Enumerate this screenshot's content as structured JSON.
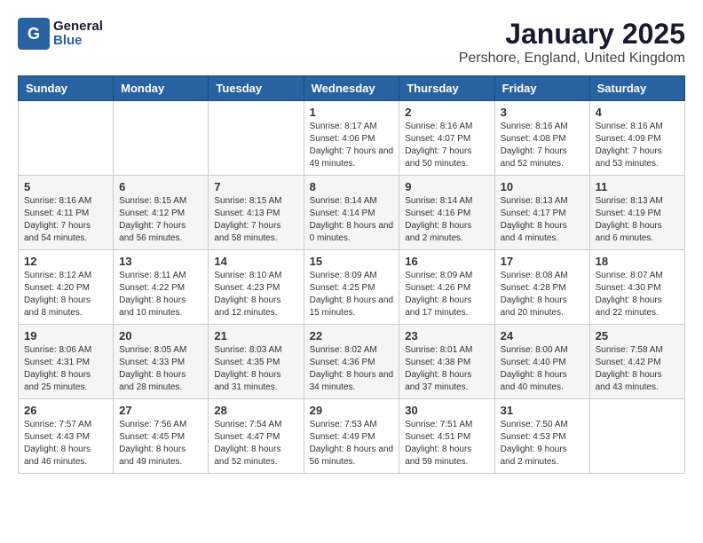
{
  "logo": {
    "general": "General",
    "blue": "Blue"
  },
  "title": "January 2025",
  "location": "Pershore, England, United Kingdom",
  "days_of_week": [
    "Sunday",
    "Monday",
    "Tuesday",
    "Wednesday",
    "Thursday",
    "Friday",
    "Saturday"
  ],
  "weeks": [
    [
      {
        "day": "",
        "sunrise": "",
        "sunset": "",
        "daylight": ""
      },
      {
        "day": "",
        "sunrise": "",
        "sunset": "",
        "daylight": ""
      },
      {
        "day": "",
        "sunrise": "",
        "sunset": "",
        "daylight": ""
      },
      {
        "day": "1",
        "sunrise": "Sunrise: 8:17 AM",
        "sunset": "Sunset: 4:06 PM",
        "daylight": "Daylight: 7 hours and 49 minutes."
      },
      {
        "day": "2",
        "sunrise": "Sunrise: 8:16 AM",
        "sunset": "Sunset: 4:07 PM",
        "daylight": "Daylight: 7 hours and 50 minutes."
      },
      {
        "day": "3",
        "sunrise": "Sunrise: 8:16 AM",
        "sunset": "Sunset: 4:08 PM",
        "daylight": "Daylight: 7 hours and 52 minutes."
      },
      {
        "day": "4",
        "sunrise": "Sunrise: 8:16 AM",
        "sunset": "Sunset: 4:09 PM",
        "daylight": "Daylight: 7 hours and 53 minutes."
      }
    ],
    [
      {
        "day": "5",
        "sunrise": "Sunrise: 8:16 AM",
        "sunset": "Sunset: 4:11 PM",
        "daylight": "Daylight: 7 hours and 54 minutes."
      },
      {
        "day": "6",
        "sunrise": "Sunrise: 8:15 AM",
        "sunset": "Sunset: 4:12 PM",
        "daylight": "Daylight: 7 hours and 56 minutes."
      },
      {
        "day": "7",
        "sunrise": "Sunrise: 8:15 AM",
        "sunset": "Sunset: 4:13 PM",
        "daylight": "Daylight: 7 hours and 58 minutes."
      },
      {
        "day": "8",
        "sunrise": "Sunrise: 8:14 AM",
        "sunset": "Sunset: 4:14 PM",
        "daylight": "Daylight: 8 hours and 0 minutes."
      },
      {
        "day": "9",
        "sunrise": "Sunrise: 8:14 AM",
        "sunset": "Sunset: 4:16 PM",
        "daylight": "Daylight: 8 hours and 2 minutes."
      },
      {
        "day": "10",
        "sunrise": "Sunrise: 8:13 AM",
        "sunset": "Sunset: 4:17 PM",
        "daylight": "Daylight: 8 hours and 4 minutes."
      },
      {
        "day": "11",
        "sunrise": "Sunrise: 8:13 AM",
        "sunset": "Sunset: 4:19 PM",
        "daylight": "Daylight: 8 hours and 6 minutes."
      }
    ],
    [
      {
        "day": "12",
        "sunrise": "Sunrise: 8:12 AM",
        "sunset": "Sunset: 4:20 PM",
        "daylight": "Daylight: 8 hours and 8 minutes."
      },
      {
        "day": "13",
        "sunrise": "Sunrise: 8:11 AM",
        "sunset": "Sunset: 4:22 PM",
        "daylight": "Daylight: 8 hours and 10 minutes."
      },
      {
        "day": "14",
        "sunrise": "Sunrise: 8:10 AM",
        "sunset": "Sunset: 4:23 PM",
        "daylight": "Daylight: 8 hours and 12 minutes."
      },
      {
        "day": "15",
        "sunrise": "Sunrise: 8:09 AM",
        "sunset": "Sunset: 4:25 PM",
        "daylight": "Daylight: 8 hours and 15 minutes."
      },
      {
        "day": "16",
        "sunrise": "Sunrise: 8:09 AM",
        "sunset": "Sunset: 4:26 PM",
        "daylight": "Daylight: 8 hours and 17 minutes."
      },
      {
        "day": "17",
        "sunrise": "Sunrise: 8:08 AM",
        "sunset": "Sunset: 4:28 PM",
        "daylight": "Daylight: 8 hours and 20 minutes."
      },
      {
        "day": "18",
        "sunrise": "Sunrise: 8:07 AM",
        "sunset": "Sunset: 4:30 PM",
        "daylight": "Daylight: 8 hours and 22 minutes."
      }
    ],
    [
      {
        "day": "19",
        "sunrise": "Sunrise: 8:06 AM",
        "sunset": "Sunset: 4:31 PM",
        "daylight": "Daylight: 8 hours and 25 minutes."
      },
      {
        "day": "20",
        "sunrise": "Sunrise: 8:05 AM",
        "sunset": "Sunset: 4:33 PM",
        "daylight": "Daylight: 8 hours and 28 minutes."
      },
      {
        "day": "21",
        "sunrise": "Sunrise: 8:03 AM",
        "sunset": "Sunset: 4:35 PM",
        "daylight": "Daylight: 8 hours and 31 minutes."
      },
      {
        "day": "22",
        "sunrise": "Sunrise: 8:02 AM",
        "sunset": "Sunset: 4:36 PM",
        "daylight": "Daylight: 8 hours and 34 minutes."
      },
      {
        "day": "23",
        "sunrise": "Sunrise: 8:01 AM",
        "sunset": "Sunset: 4:38 PM",
        "daylight": "Daylight: 8 hours and 37 minutes."
      },
      {
        "day": "24",
        "sunrise": "Sunrise: 8:00 AM",
        "sunset": "Sunset: 4:40 PM",
        "daylight": "Daylight: 8 hours and 40 minutes."
      },
      {
        "day": "25",
        "sunrise": "Sunrise: 7:58 AM",
        "sunset": "Sunset: 4:42 PM",
        "daylight": "Daylight: 8 hours and 43 minutes."
      }
    ],
    [
      {
        "day": "26",
        "sunrise": "Sunrise: 7:57 AM",
        "sunset": "Sunset: 4:43 PM",
        "daylight": "Daylight: 8 hours and 46 minutes."
      },
      {
        "day": "27",
        "sunrise": "Sunrise: 7:56 AM",
        "sunset": "Sunset: 4:45 PM",
        "daylight": "Daylight: 8 hours and 49 minutes."
      },
      {
        "day": "28",
        "sunrise": "Sunrise: 7:54 AM",
        "sunset": "Sunset: 4:47 PM",
        "daylight": "Daylight: 8 hours and 52 minutes."
      },
      {
        "day": "29",
        "sunrise": "Sunrise: 7:53 AM",
        "sunset": "Sunset: 4:49 PM",
        "daylight": "Daylight: 8 hours and 56 minutes."
      },
      {
        "day": "30",
        "sunrise": "Sunrise: 7:51 AM",
        "sunset": "Sunset: 4:51 PM",
        "daylight": "Daylight: 8 hours and 59 minutes."
      },
      {
        "day": "31",
        "sunrise": "Sunrise: 7:50 AM",
        "sunset": "Sunset: 4:53 PM",
        "daylight": "Daylight: 9 hours and 2 minutes."
      },
      {
        "day": "",
        "sunrise": "",
        "sunset": "",
        "daylight": ""
      }
    ]
  ]
}
